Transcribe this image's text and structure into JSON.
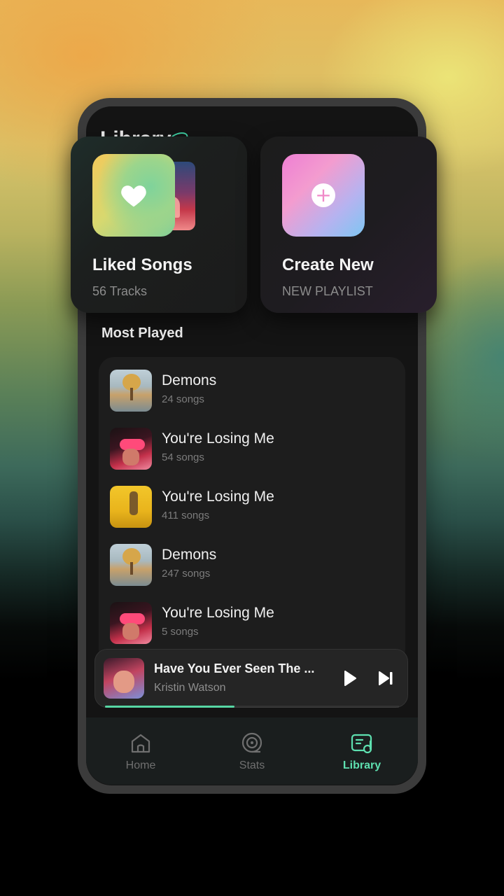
{
  "library": {
    "title": "Library"
  },
  "cards": {
    "liked": {
      "title": "Liked Songs",
      "subtitle": "56 Tracks"
    },
    "create": {
      "title": "Create New",
      "subtitle": "NEW PLAYLIST"
    }
  },
  "most_played": {
    "title": "Most Played",
    "items": [
      {
        "title": "Demons",
        "subtitle": "24 songs"
      },
      {
        "title": "You're Losing Me",
        "subtitle": "54 songs"
      },
      {
        "title": "You're Losing Me",
        "subtitle": "411 songs"
      },
      {
        "title": "Demons",
        "subtitle": "247 songs"
      },
      {
        "title": "You're Losing Me",
        "subtitle": "5 songs"
      }
    ]
  },
  "player": {
    "title": "Have You Ever Seen The ...",
    "artist": "Kristin Watson",
    "progress": 0.44
  },
  "nav": {
    "items": [
      {
        "label": "Home",
        "icon": "home-icon",
        "active": false
      },
      {
        "label": "Stats",
        "icon": "stats-icon",
        "active": false
      },
      {
        "label": "Library",
        "icon": "library-icon",
        "active": true
      }
    ]
  },
  "colors": {
    "accent": "#5ee0b0",
    "background": "#141414",
    "card": "#1d1d1d"
  }
}
